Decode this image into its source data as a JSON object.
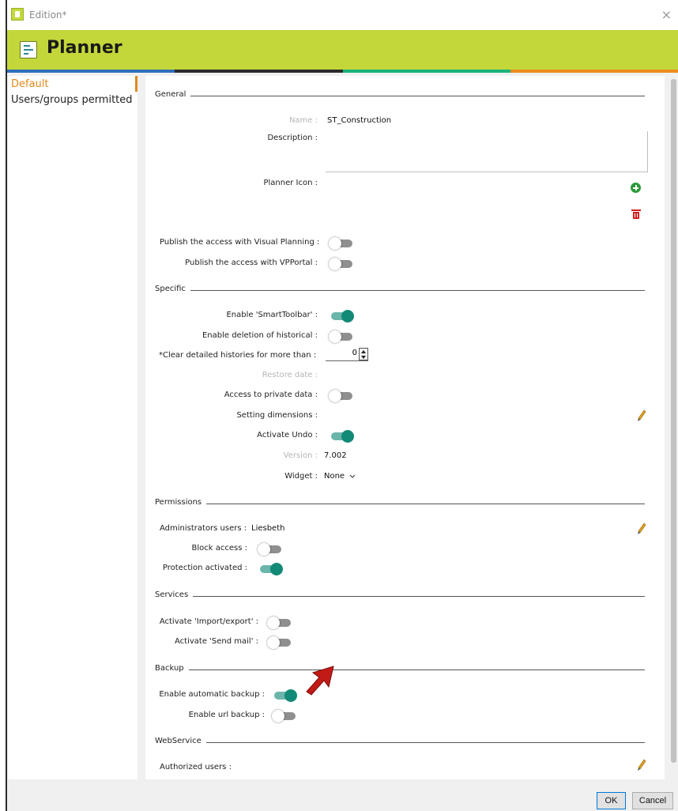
{
  "window": {
    "title": "Edition*",
    "close_glyph": "×"
  },
  "app": {
    "name": "Planner",
    "icon": "planner-icon"
  },
  "stripe_colors": [
    "#2f6fb8",
    "#2b2b2b",
    "#19b37b",
    "#ec8a1c"
  ],
  "accent_color": "#c4d73a",
  "toggle_on_color": "#138a78",
  "sidebar": {
    "items": [
      {
        "label": "Default",
        "active": true
      },
      {
        "label": "Users/groups permitted",
        "active": false
      }
    ]
  },
  "general": {
    "title": "General",
    "name_label": "Name :",
    "name_value": "ST_Construction",
    "description_label": "Description :",
    "planner_icon_label": "Planner Icon :",
    "publish_vp_label": "Publish the access with Visual Planning :",
    "publish_vp_on": false,
    "publish_portal_label": "Publish the access with VPPortal :",
    "publish_portal_on": false
  },
  "specific": {
    "title": "Specific",
    "smart_toolbar_label": "Enable 'SmartToolbar' :",
    "smart_toolbar_on": true,
    "deletion_hist_label": "Enable deletion of historical :",
    "deletion_hist_on": false,
    "clear_hist_label": "*Clear detailed histories for more than :",
    "clear_hist_value": "0",
    "restore_date_label": "Restore date :",
    "private_data_label": "Access to private data :",
    "private_data_on": false,
    "setting_dims_label": "Setting dimensions :",
    "activate_undo_label": "Activate Undo :",
    "activate_undo_on": true,
    "version_label": "Version :",
    "version_value": "7.002",
    "widget_label": "Widget :",
    "widget_value": "None"
  },
  "permissions": {
    "title": "Permissions",
    "admin_users_label": "Administrators users :",
    "admin_users_value": "Liesbeth",
    "block_access_label": "Block access :",
    "block_access_on": false,
    "protection_label": "Protection activated :",
    "protection_on": true
  },
  "services": {
    "title": "Services",
    "import_export_label": "Activate 'Import/export' :",
    "import_export_on": false,
    "send_mail_label": "Activate 'Send mail' :",
    "send_mail_on": false
  },
  "backup": {
    "title": "Backup",
    "auto_backup_label": "Enable automatic backup :",
    "auto_backup_on": true,
    "url_backup_label": "Enable url backup :",
    "url_backup_on": false
  },
  "webservice": {
    "title": "WebService",
    "authorized_users_label": "Authorized users :"
  },
  "footer": {
    "ok_label": "OK",
    "cancel_label": "Cancel"
  }
}
